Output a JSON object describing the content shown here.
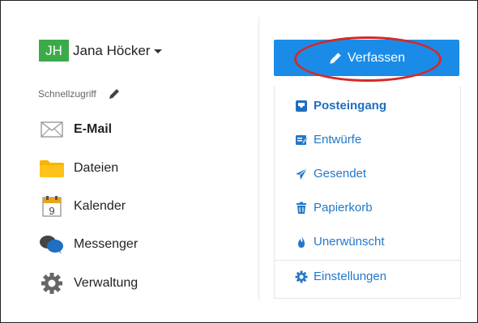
{
  "user": {
    "initials": "JH",
    "name": "Jana Höcker"
  },
  "quick_access": {
    "label": "Schnellzugriff"
  },
  "nav": [
    {
      "label": "E-Mail",
      "icon": "envelope-icon"
    },
    {
      "label": "Dateien",
      "icon": "folder-icon"
    },
    {
      "label": "Kalender",
      "icon": "calendar-icon",
      "calendar_day": "9"
    },
    {
      "label": "Messenger",
      "icon": "chat-bubbles-icon"
    },
    {
      "label": "Verwaltung",
      "icon": "gear-icon"
    }
  ],
  "compose": {
    "label": "Verfassen"
  },
  "folders": [
    {
      "label": "Posteingang",
      "icon": "inbox-icon"
    },
    {
      "label": "Entwürfe",
      "icon": "drafts-icon"
    },
    {
      "label": "Gesendet",
      "icon": "paper-plane-icon"
    },
    {
      "label": "Papierkorb",
      "icon": "trash-icon"
    },
    {
      "label": "Unerwünscht",
      "icon": "fire-icon"
    }
  ],
  "settings": {
    "label": "Einstellungen",
    "icon": "gear-icon"
  },
  "colors": {
    "accent": "#1a8ce8",
    "link": "#2477c8",
    "avatar": "#3bab4a",
    "annotation": "#d32a2a"
  }
}
